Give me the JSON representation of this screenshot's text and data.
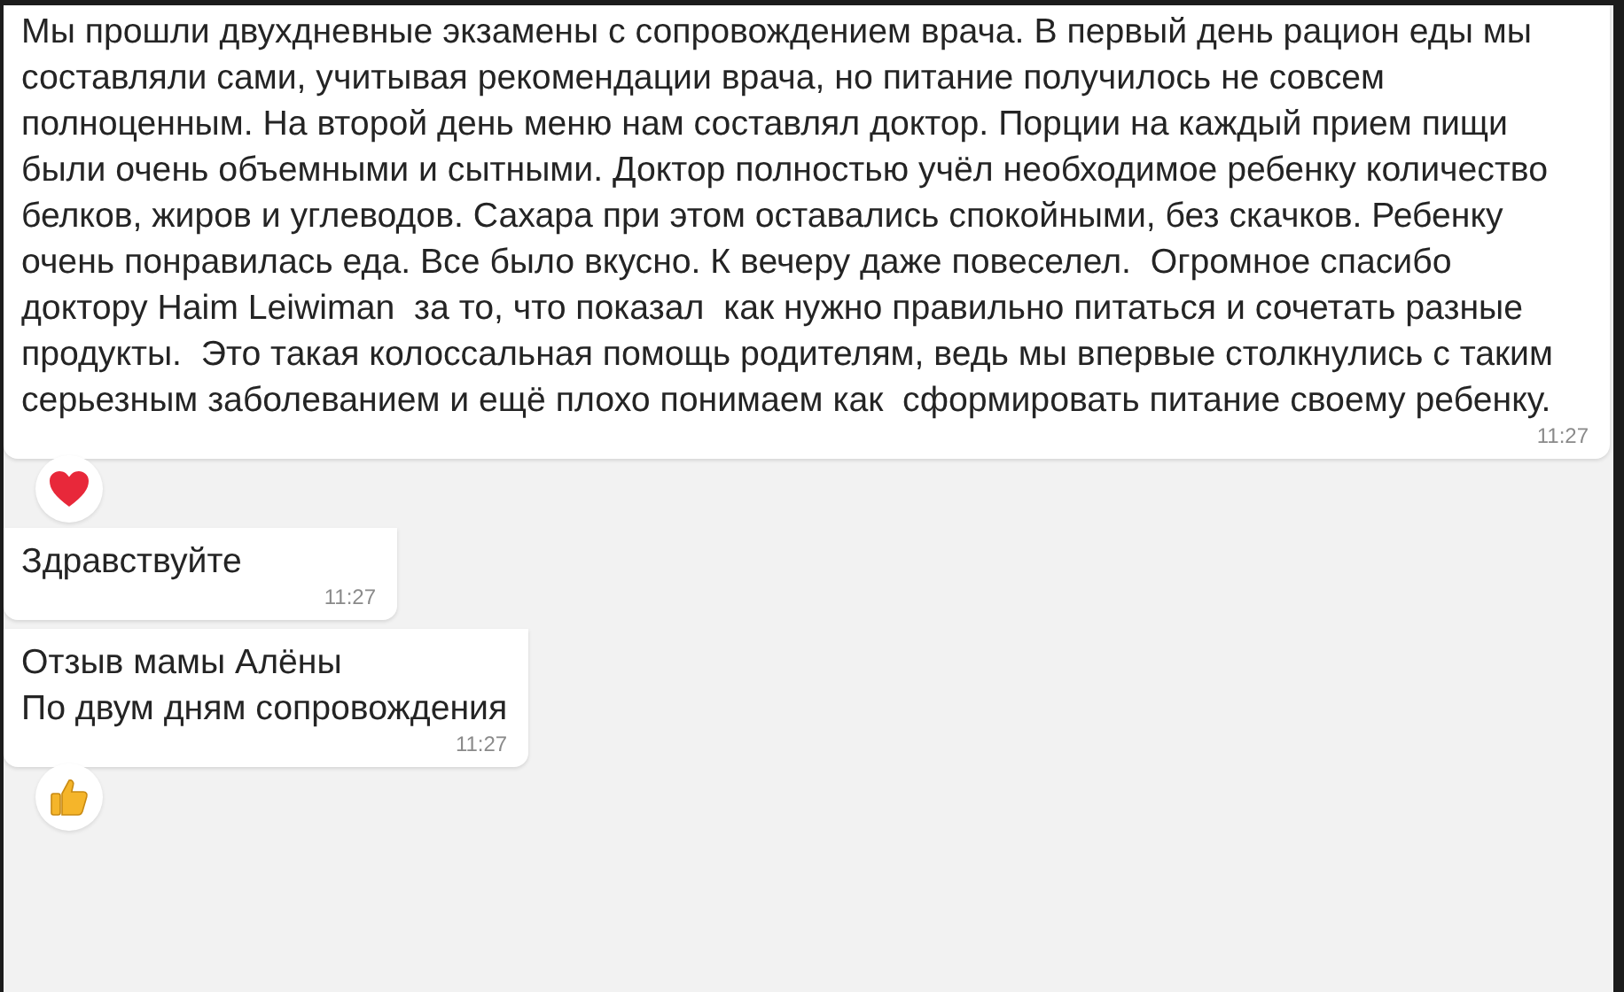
{
  "messages": [
    {
      "text": "Мы прошли двухдневные экзамены с сопровождением врача. В первый день рацион еды мы составляли сами, учитывая рекомендации врача, но питание получилось не совсем полноценным. На второй день меню нам составлял доктор. Порции на каждый прием пищи были очень объемными и сытными. Доктор полностью учёл необходимое ребенку количество белков, жиров и углеводов. Сахара при этом оставались спокойными, без скачков. Ребенку очень понравилась еда. Все было вкусно. К вечеру даже повеселел.  Огромное спасибо доктору Haim Leiwiman  за то, что показал  как нужно правильно питаться и сочетать разные продукты.  Это такая колоссальная помощь родителям, ведь мы впервые столкнулись с таким серьезным заболеванием и ещё плохо понимаем как  сформировать питание своему ребенку.",
      "time": "11:27",
      "reaction": {
        "kind": "heart"
      }
    },
    {
      "text": "Здравствуйте",
      "time": "11:27"
    },
    {
      "text": "Отзыв мамы Алёны\nПо двум дням сопровождения",
      "time": "11:27",
      "reaction": {
        "kind": "thumbs-up"
      }
    }
  ]
}
